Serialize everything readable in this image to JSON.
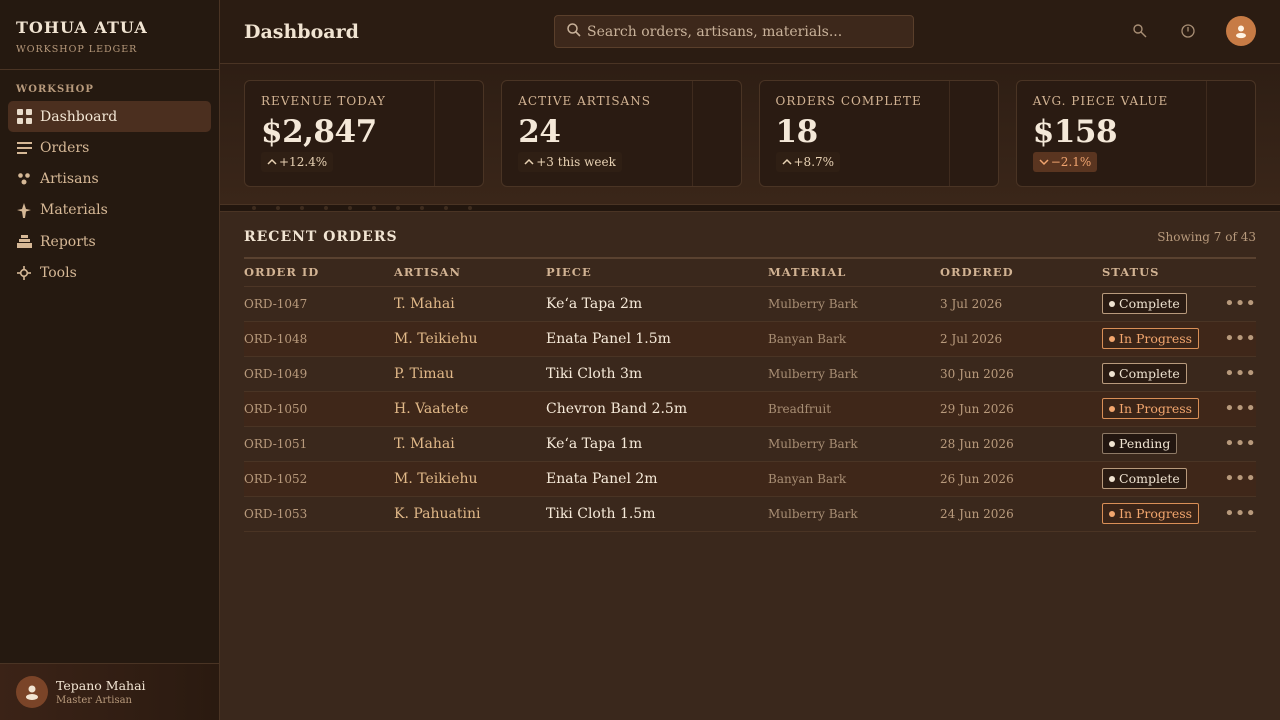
{
  "brand": {
    "title": "TOHUA ATUA",
    "subtitle": "WORKSHOP LEDGER"
  },
  "sidebar": {
    "section": "WORKSHOP",
    "items": [
      {
        "label": "Dashboard",
        "icon": "grid-icon",
        "active": true
      },
      {
        "label": "Orders",
        "icon": "list-icon"
      },
      {
        "label": "Artisans",
        "icon": "people-icon"
      },
      {
        "label": "Materials",
        "icon": "leaf-icon"
      },
      {
        "label": "Reports",
        "icon": "stack-icon"
      },
      {
        "label": "Tools",
        "icon": "gear-icon"
      }
    ]
  },
  "user": {
    "name": "Tepano Mahai",
    "role": "Master Artisan"
  },
  "header": {
    "title": "Dashboard",
    "search_placeholder": "Search orders, artisans, materials..."
  },
  "stats": [
    {
      "label": "REVENUE TODAY",
      "value": "$2,847",
      "delta": "+12.4%",
      "trend": "up"
    },
    {
      "label": "ACTIVE ARTISANS",
      "value": "24",
      "delta": "+3 this week",
      "trend": "up"
    },
    {
      "label": "ORDERS COMPLETE",
      "value": "18",
      "delta": "+8.7%",
      "trend": "up"
    },
    {
      "label": "AVG. PIECE VALUE",
      "value": "$158",
      "delta": "−2.1%",
      "trend": "down"
    }
  ],
  "orders": {
    "title": "RECENT ORDERS",
    "count": "Showing 7 of 43",
    "columns": [
      "ORDER ID",
      "ARTISAN",
      "PIECE",
      "MATERIAL",
      "ORDERED",
      "STATUS"
    ],
    "rows": [
      {
        "id": "ORD-1047",
        "artisan": "T. Mahai",
        "piece": "Keʻa Tapa 2m",
        "material": "Mulberry Bark",
        "date": "3 Jul 2026",
        "status": "Complete"
      },
      {
        "id": "ORD-1048",
        "artisan": "M. Teikiehu",
        "piece": "Enata Panel 1.5m",
        "material": "Banyan Bark",
        "date": "2 Jul 2026",
        "status": "In Progress"
      },
      {
        "id": "ORD-1049",
        "artisan": "P. Timau",
        "piece": "Tiki Cloth 3m",
        "material": "Mulberry Bark",
        "date": "30 Jun 2026",
        "status": "Complete"
      },
      {
        "id": "ORD-1050",
        "artisan": "H. Vaatete",
        "piece": "Chevron Band 2.5m",
        "material": "Breadfruit",
        "date": "29 Jun 2026",
        "status": "In Progress"
      },
      {
        "id": "ORD-1051",
        "artisan": "T. Mahai",
        "piece": "Keʻa Tapa 1m",
        "material": "Mulberry Bark",
        "date": "28 Jun 2026",
        "status": "Pending"
      },
      {
        "id": "ORD-1052",
        "artisan": "M. Teikiehu",
        "piece": "Enata Panel 2m",
        "material": "Banyan Bark",
        "date": "26 Jun 2026",
        "status": "Complete"
      },
      {
        "id": "ORD-1053",
        "artisan": "K. Pahuatini",
        "piece": "Tiki Cloth 1.5m",
        "material": "Mulberry Bark",
        "date": "24 Jun 2026",
        "status": "In Progress"
      }
    ]
  },
  "colors": {
    "accent": "#c77b45",
    "progress": "#f2a66e",
    "background": "#3a281c"
  }
}
